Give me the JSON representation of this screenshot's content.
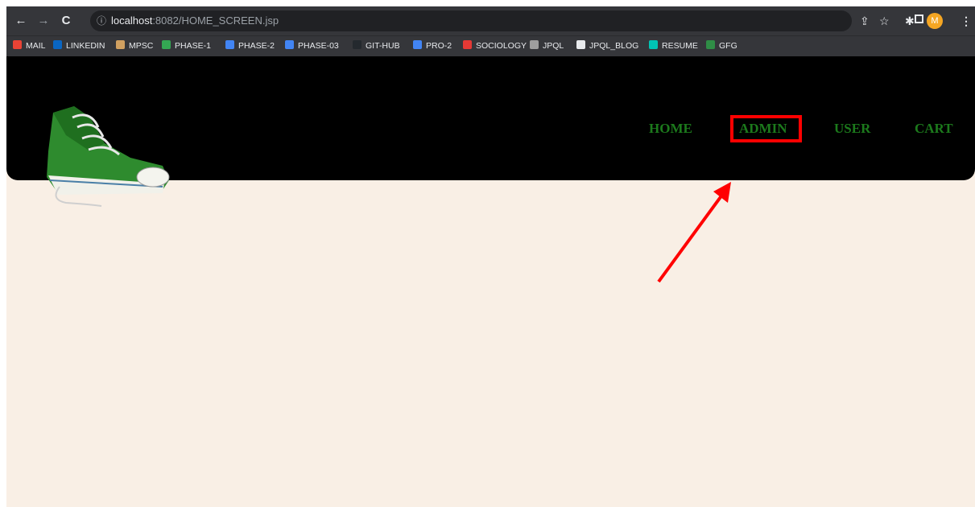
{
  "browser": {
    "url_host": "localhost",
    "url_path": ":8082/HOME_SCREEN.jsp",
    "avatar_letter": "M",
    "bookmarks": [
      {
        "label": "MAIL",
        "icon": "gmail-icon",
        "color": "#ea4335"
      },
      {
        "label": "LINKEDIN",
        "icon": "linkedin-icon",
        "color": "#0a66c2"
      },
      {
        "label": "MPSC",
        "icon": "mpsc-icon",
        "color": "#d0a060"
      },
      {
        "label": "PHASE-1",
        "icon": "drive-icon",
        "color": "#34a853"
      },
      {
        "label": "PHASE-2",
        "icon": "docs-icon",
        "color": "#4285f4"
      },
      {
        "label": "PHASE-03",
        "icon": "docs-icon",
        "color": "#4285f4"
      },
      {
        "label": "GIT-HUB",
        "icon": "github-icon",
        "color": "#24292e"
      },
      {
        "label": "PRO-2",
        "icon": "docs-icon",
        "color": "#4285f4"
      },
      {
        "label": "SOCIOLOGY",
        "icon": "sociology-icon",
        "color": "#e53935"
      },
      {
        "label": "JPQL",
        "icon": "jpql-icon",
        "color": "#9e9e9e"
      },
      {
        "label": "JPQL_BLOG",
        "icon": "globe-icon",
        "color": "#e8eaed"
      },
      {
        "label": "RESUME",
        "icon": "resume-icon",
        "color": "#00c4b4"
      },
      {
        "label": "GFG",
        "icon": "gfg-icon",
        "color": "#2f8d46"
      }
    ]
  },
  "site": {
    "nav": [
      {
        "label": "HOME"
      },
      {
        "label": "ADMIN"
      },
      {
        "label": "USER"
      },
      {
        "label": "CART"
      }
    ],
    "accent_color": "#1c7a1c",
    "background_color": "#f9efe5",
    "header_color": "#000000",
    "annotation_color": "#ff0000"
  }
}
